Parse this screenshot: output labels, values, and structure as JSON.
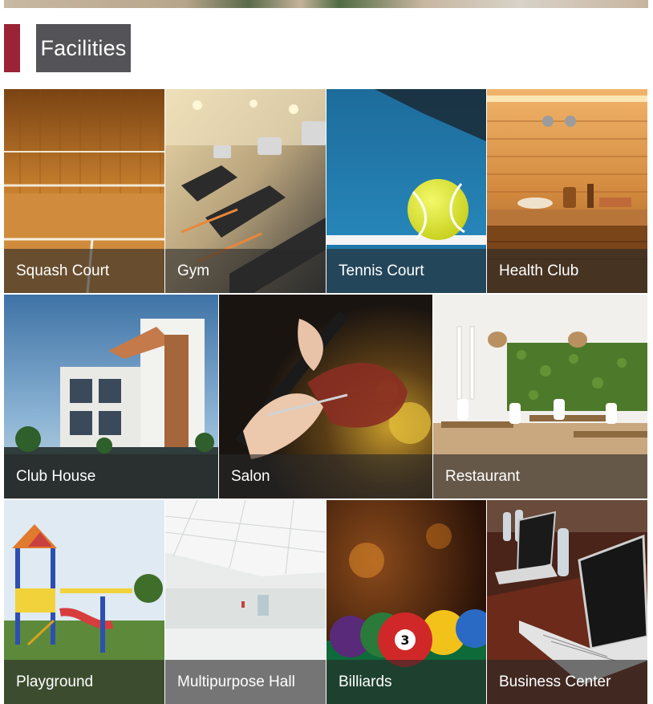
{
  "section": {
    "title": "Facilities"
  },
  "facilities": [
    {
      "label": "Squash Court",
      "icon": "squash-court-photo"
    },
    {
      "label": "Gym",
      "icon": "gym-photo"
    },
    {
      "label": "Tennis Court",
      "icon": "tennis-court-photo"
    },
    {
      "label": "Health Club",
      "icon": "health-club-photo"
    },
    {
      "label": "Club House",
      "icon": "club-house-photo"
    },
    {
      "label": "Salon",
      "icon": "salon-photo"
    },
    {
      "label": "Restaurant",
      "icon": "restaurant-photo"
    },
    {
      "label": "Playground",
      "icon": "playground-photo"
    },
    {
      "label": "Multipurpose Hall",
      "icon": "multipurpose-hall-photo"
    },
    {
      "label": "Billiards",
      "icon": "billiards-photo"
    },
    {
      "label": "Business Center",
      "icon": "business-center-photo"
    }
  ],
  "colors": {
    "accent": "#9b2335",
    "title_bg": "#545458",
    "caption_bg": "#282828"
  }
}
